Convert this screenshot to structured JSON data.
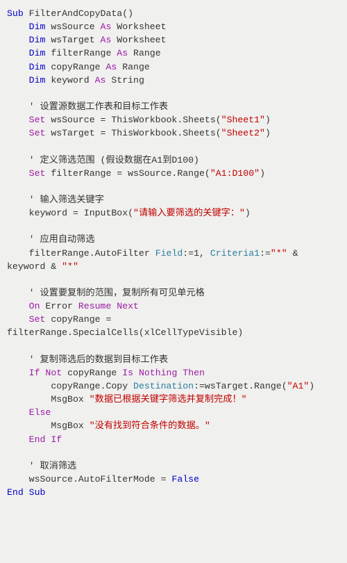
{
  "code": {
    "indent": "    ",
    "tokens": [
      [
        [
          "kw2",
          "Sub"
        ],
        [
          "",
          " FilterAndCopyData()"
        ]
      ],
      [
        [
          "",
          "    "
        ],
        [
          "kw2",
          "Dim"
        ],
        [
          "",
          " wsSource "
        ],
        [
          "kw",
          "As"
        ],
        [
          "",
          " Worksheet"
        ]
      ],
      [
        [
          "",
          "    "
        ],
        [
          "kw2",
          "Dim"
        ],
        [
          "",
          " wsTarget "
        ],
        [
          "kw",
          "As"
        ],
        [
          "",
          " Worksheet"
        ]
      ],
      [
        [
          "",
          "    "
        ],
        [
          "kw2",
          "Dim"
        ],
        [
          "",
          " filterRange "
        ],
        [
          "kw",
          "As"
        ],
        [
          "",
          " Range"
        ]
      ],
      [
        [
          "",
          "    "
        ],
        [
          "kw2",
          "Dim"
        ],
        [
          "",
          " copyRange "
        ],
        [
          "kw",
          "As"
        ],
        [
          "",
          " Range"
        ]
      ],
      [
        [
          "",
          "    "
        ],
        [
          "kw2",
          "Dim"
        ],
        [
          "",
          " keyword "
        ],
        [
          "kw",
          "As"
        ],
        [
          "",
          " String"
        ]
      ],
      [
        [
          "",
          ""
        ]
      ],
      [
        [
          "",
          "    "
        ],
        [
          "cmt",
          "' 设置源数据工作表和目标工作表"
        ]
      ],
      [
        [
          "",
          "    "
        ],
        [
          "kw",
          "Set"
        ],
        [
          "",
          " wsSource = ThisWorkbook.Sheets("
        ],
        [
          "str",
          "\"Sheet1\""
        ],
        [
          "",
          ")"
        ]
      ],
      [
        [
          "",
          "    "
        ],
        [
          "kw",
          "Set"
        ],
        [
          "",
          " wsTarget = ThisWorkbook.Sheets("
        ],
        [
          "str",
          "\"Sheet2\""
        ],
        [
          "",
          ")"
        ]
      ],
      [
        [
          "",
          ""
        ]
      ],
      [
        [
          "",
          "    "
        ],
        [
          "cmt",
          "' 定义筛选范围 (假设数据在A1到D100)"
        ]
      ],
      [
        [
          "",
          "    "
        ],
        [
          "kw",
          "Set"
        ],
        [
          "",
          " filterRange = wsSource.Range("
        ],
        [
          "str",
          "\"A1:D100\""
        ],
        [
          "",
          ")"
        ]
      ],
      [
        [
          "",
          ""
        ]
      ],
      [
        [
          "",
          "    "
        ],
        [
          "cmt",
          "' 输入筛选关键字"
        ]
      ],
      [
        [
          "",
          "    keyword = InputBox("
        ],
        [
          "str",
          "\"请输入要筛选的关键字：\""
        ],
        [
          "",
          ")"
        ]
      ],
      [
        [
          "",
          ""
        ]
      ],
      [
        [
          "",
          "    "
        ],
        [
          "cmt",
          "' 应用自动筛选"
        ]
      ],
      [
        [
          "",
          "    filterRange.AutoFilter "
        ],
        [
          "arg",
          "Field"
        ],
        [
          "",
          ":=1, "
        ],
        [
          "arg",
          "Criteria1"
        ],
        [
          "",
          ":="
        ],
        [
          "str",
          "\"*\""
        ],
        [
          "",
          " & keyword & "
        ],
        [
          "str",
          "\"*\""
        ]
      ],
      [
        [
          "",
          ""
        ]
      ],
      [
        [
          "",
          "    "
        ],
        [
          "cmt",
          "' 设置要复制的范围，复制所有可见单元格"
        ]
      ],
      [
        [
          "",
          "    "
        ],
        [
          "kw",
          "On"
        ],
        [
          "",
          " Error "
        ],
        [
          "kw",
          "Resume"
        ],
        [
          "",
          " "
        ],
        [
          "kw",
          "Next"
        ]
      ],
      [
        [
          "",
          "    "
        ],
        [
          "kw",
          "Set"
        ],
        [
          "",
          " copyRange = filterRange.SpecialCells(xlCellTypeVisible)"
        ]
      ],
      [
        [
          "",
          ""
        ]
      ],
      [
        [
          "",
          "    "
        ],
        [
          "cmt",
          "' 复制筛选后的数据到目标工作表"
        ]
      ],
      [
        [
          "",
          "    "
        ],
        [
          "kw",
          "If"
        ],
        [
          "",
          " "
        ],
        [
          "kw",
          "Not"
        ],
        [
          "",
          " copyRange "
        ],
        [
          "kw",
          "Is"
        ],
        [
          "",
          " "
        ],
        [
          "kw",
          "Nothing"
        ],
        [
          "",
          " "
        ],
        [
          "kw",
          "Then"
        ]
      ],
      [
        [
          "",
          "        copyRange.Copy "
        ],
        [
          "arg",
          "Destination"
        ],
        [
          "",
          ":=wsTarget.Range("
        ],
        [
          "str",
          "\"A1\""
        ],
        [
          "",
          ")"
        ]
      ],
      [
        [
          "",
          "        MsgBox "
        ],
        [
          "str",
          "\"数据已根据关键字筛选并复制完成！\""
        ]
      ],
      [
        [
          "",
          "    "
        ],
        [
          "kw",
          "Else"
        ]
      ],
      [
        [
          "",
          "        MsgBox "
        ],
        [
          "str",
          "\"没有找到符合条件的数据。\""
        ]
      ],
      [
        [
          "",
          "    "
        ],
        [
          "kw",
          "End"
        ],
        [
          "",
          " "
        ],
        [
          "kw",
          "If"
        ]
      ],
      [
        [
          "",
          ""
        ]
      ],
      [
        [
          "",
          "    "
        ],
        [
          "cmt",
          "' 取消筛选"
        ]
      ],
      [
        [
          "",
          "    wsSource.AutoFilterMode = "
        ],
        [
          "kw2",
          "False"
        ]
      ],
      [
        [
          "kw2",
          "End"
        ],
        [
          "",
          " "
        ],
        [
          "kw2",
          "Sub"
        ]
      ]
    ]
  }
}
